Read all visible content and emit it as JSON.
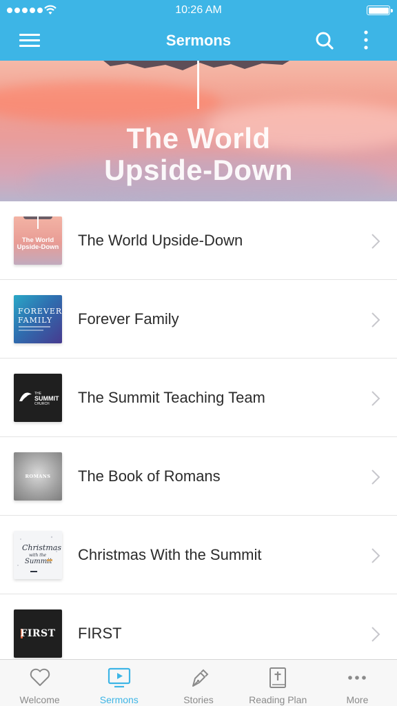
{
  "status_bar": {
    "time": "10:26 AM"
  },
  "nav": {
    "title": "Sermons"
  },
  "banner": {
    "title_line1": "The World",
    "title_line2": "Upside-Down"
  },
  "sermons": [
    {
      "title": "The World Upside-Down",
      "thumb_text": "The World Upside-Down"
    },
    {
      "title": "Forever Family",
      "thumb_text": "FOREVER FAMILY"
    },
    {
      "title": "The Summit Teaching Team",
      "thumb_text": "THE SUMMIT CHURCH"
    },
    {
      "title": "The Book of Romans",
      "thumb_text": "ROMANS"
    },
    {
      "title": "Christmas With the Summit",
      "thumb_text": "Christmas with the Summit"
    },
    {
      "title": "FIRST",
      "thumb_text": "FIRST"
    }
  ],
  "tabs": [
    {
      "label": "Welcome",
      "icon": "heart-icon",
      "active": false
    },
    {
      "label": "Sermons",
      "icon": "play-screen-icon",
      "active": true
    },
    {
      "label": "Stories",
      "icon": "pen-nib-icon",
      "active": false
    },
    {
      "label": "Reading Plan",
      "icon": "bible-icon",
      "active": false
    },
    {
      "label": "More",
      "icon": "ellipsis-icon",
      "active": false
    }
  ],
  "colors": {
    "accent": "#3db5e6",
    "tab_inactive": "#8a8a8a",
    "text": "#2b2b2b"
  }
}
